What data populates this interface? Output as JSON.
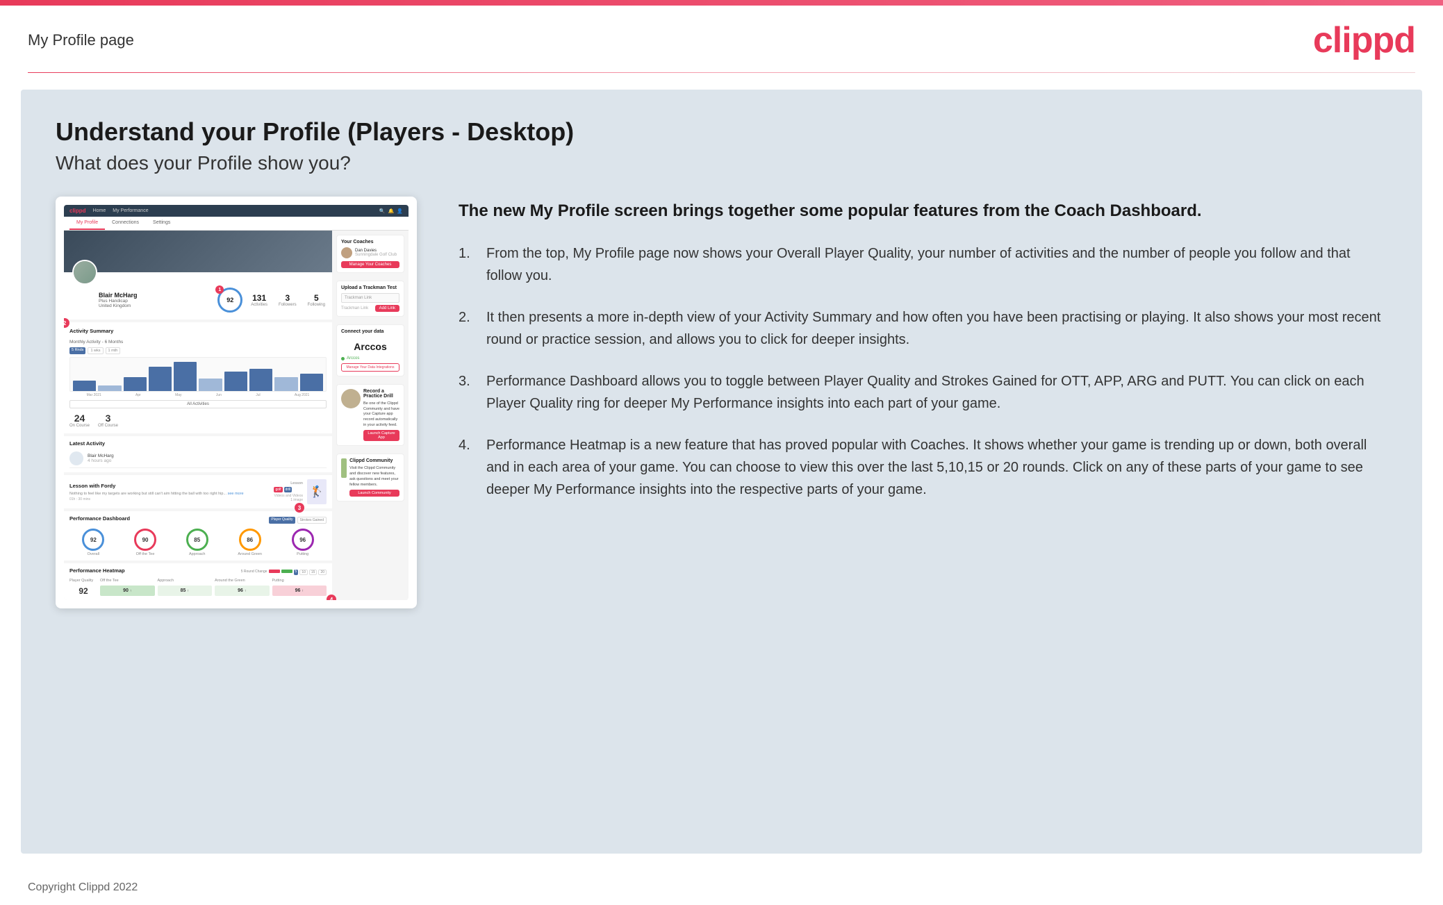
{
  "header": {
    "page_title": "My Profile page",
    "logo": "clippd"
  },
  "main": {
    "title": "Understand your Profile (Players - Desktop)",
    "subtitle": "What does your Profile show you?",
    "intro_bold": "The new My Profile screen brings together some popular features from the Coach Dashboard.",
    "list_items": [
      {
        "number": "1.",
        "text": "From the top, My Profile page now shows your Overall Player Quality, your number of activities and the number of people you follow and that follow you."
      },
      {
        "number": "2.",
        "text": "It then presents a more in-depth view of your Activity Summary and how often you have been practising or playing. It also shows your most recent round or practice session, and allows you to click for deeper insights."
      },
      {
        "number": "3.",
        "text": "Performance Dashboard allows you to toggle between Player Quality and Strokes Gained for OTT, APP, ARG and PUTT. You can click on each Player Quality ring for deeper My Performance insights into each part of your game."
      },
      {
        "number": "4.",
        "text": "Performance Heatmap is a new feature that has proved popular with Coaches. It shows whether your game is trending up or down, both overall and in each area of your game. You can choose to view this over the last 5,10,15 or 20 rounds. Click on any of these parts of your game to see deeper My Performance insights into the respective parts of your game."
      }
    ]
  },
  "mock_app": {
    "nav": {
      "logo": "clippd",
      "items": [
        "Home",
        "My Performance"
      ]
    },
    "tabs": [
      "My Profile",
      "Connections",
      "Settings"
    ],
    "player": {
      "name": "Blair McHarg",
      "handicap": "Plus Handicap",
      "location": "United Kingdom",
      "quality": "92",
      "activities": "131",
      "followers": "3",
      "following": "5"
    },
    "activity": {
      "title": "Activity Summary",
      "subtitle": "Monthly Activity - 6 Months",
      "on_course": "24",
      "off_course": "3"
    },
    "performance": {
      "rings": [
        {
          "value": "92",
          "color": "blue"
        },
        {
          "value": "90",
          "color": "red"
        },
        {
          "value": "85",
          "color": "green"
        },
        {
          "value": "86",
          "color": "orange"
        },
        {
          "value": "96",
          "color": "purple"
        }
      ]
    },
    "heatmap": {
      "cells": [
        {
          "label": "Player Quality",
          "value": "92"
        },
        {
          "label": "Off the Tee",
          "value": "90"
        },
        {
          "label": "Approach",
          "value": "85"
        },
        {
          "label": "Around the Green",
          "value": "96"
        },
        {
          "label": "Putting",
          "value": "96"
        }
      ]
    },
    "coaches": {
      "title": "Your Coaches",
      "coach_name": "Dan Davies",
      "club": "Sunningdale Golf Club",
      "btn_label": "Manage Your Coaches"
    },
    "trackman": {
      "title": "Upload a Trackman Test",
      "placeholder": "Trackman Link",
      "btn_label": "Add Link"
    },
    "connect": {
      "title": "Connect your data",
      "brand": "Arccos",
      "status": "Arccos",
      "btn_manage": "Manage Your Data Integrations"
    },
    "drill": {
      "title": "Record a Practice Drill",
      "text": "Be one of the Clippd Community and have your Capture app record automatically in your activity feed.",
      "btn": "Launch Capture App"
    },
    "community": {
      "title": "Clippd Community",
      "text": "Visit the Clippd Community and discover new features, ask questions and meet your fellow members.",
      "btn": "Launch Community"
    }
  },
  "footer": {
    "text": "Copyright Clippd 2022"
  }
}
